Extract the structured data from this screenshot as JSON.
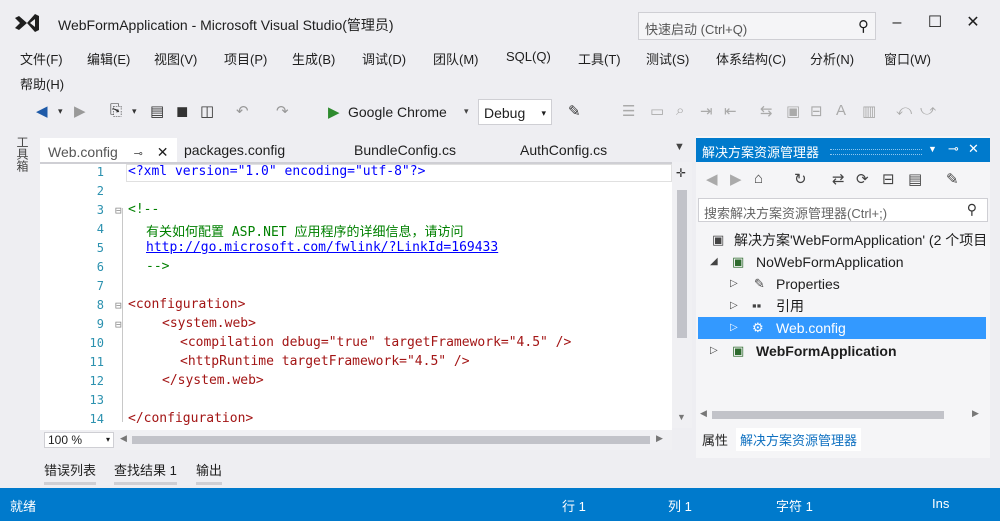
{
  "window": {
    "title": "WebFormApplication - Microsoft Visual Studio(管理员)",
    "quick_launch_placeholder": "快速启动 (Ctrl+Q)",
    "controls": [
      "‒",
      "☐",
      "✕"
    ]
  },
  "menu": {
    "items": [
      "文件(F)",
      "编辑(E)",
      "视图(V)",
      "项目(P)",
      "生成(B)",
      "调试(D)",
      "团队(M)",
      "SQL(Q)",
      "工具(T)",
      "测试(S)",
      "体系结构(C)",
      "分析(N)",
      "窗口(W)"
    ],
    "help": "帮助(H)"
  },
  "toolbar": {
    "run_target": "Google Chrome",
    "configuration": "Debug"
  },
  "side_strip": {
    "toolbox_label": "工具箱"
  },
  "editor": {
    "tabs": [
      "Web.config",
      "packages.config",
      "BundleConfig.cs",
      "AuthConfig.cs"
    ],
    "line_numbers": [
      "1",
      "2",
      "3",
      "4",
      "5",
      "6",
      "7",
      "8",
      "9",
      "10",
      "11",
      "12",
      "13",
      "14"
    ],
    "code": {
      "l1": "<?xml version=\"1.0\" encoding=\"utf-8\"?>",
      "l3": "<!--",
      "l4": "有关如何配置 ASP.NET 应用程序的详细信息，请访问",
      "l5": "http://go.microsoft.com/fwlink/?LinkId=169433",
      "l6": "-->",
      "l8": "<configuration>",
      "l9": "<system.web>",
      "l10": "<compilation debug=\"true\" targetFramework=\"4.5\" />",
      "l11": "<httpRuntime targetFramework=\"4.5\" />",
      "l12": "</system.web>",
      "l14": "</configuration>"
    },
    "zoom": "100 %"
  },
  "bottom_tabs": [
    "错误列表",
    "查找结果 1",
    "输出"
  ],
  "solution_explorer": {
    "title": "解决方案资源管理器",
    "search_placeholder": "搜索解决方案资源管理器(Ctrl+;)",
    "tree": {
      "solution": "解决方案'WebFormApplication' (2 个项目)",
      "project1": "NoWebFormApplication",
      "properties": "Properties",
      "references": "引用",
      "webconfig": "Web.config",
      "project2": "WebFormApplication"
    },
    "bottom_tabs": [
      "属性",
      "解决方案资源管理器"
    ]
  },
  "status": {
    "ready": "就绪",
    "line": "行 1",
    "col": "列 1",
    "char": "字符 1",
    "mode": "Ins"
  },
  "colors": {
    "accent": "#007acc",
    "selection": "#3399ff",
    "background": "#eeeef2"
  }
}
